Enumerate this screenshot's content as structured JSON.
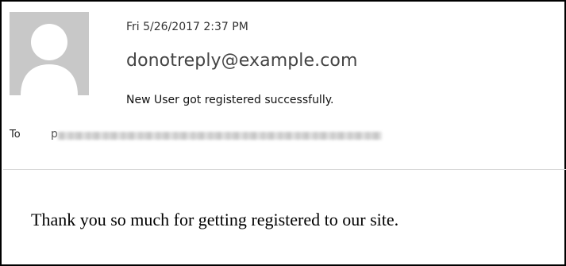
{
  "email": {
    "timestamp": "Fri 5/26/2017 2:37 PM",
    "sender": "donotreply@example.com",
    "subject": "New User got registered successfully.",
    "to_label": "To",
    "recipient_first_char": "p",
    "body": "Thank you so much for getting registered to our site."
  },
  "icons": {
    "avatar": "default-user-silhouette-icon"
  },
  "colors": {
    "avatar_bg": "#c8c8c8",
    "avatar_figure": "#ffffff",
    "divider": "#d8d8d8"
  }
}
